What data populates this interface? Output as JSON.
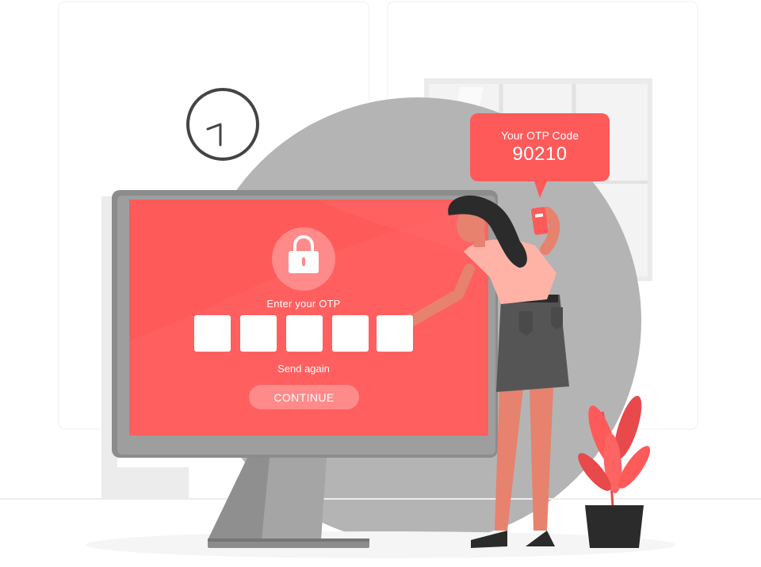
{
  "screen": {
    "prompt_label": "Enter your OTP",
    "otp_digits": [
      "",
      "",
      "",
      "",
      ""
    ],
    "resend_label": "Send again",
    "continue_label": "CONTINUE"
  },
  "notification": {
    "title": "Your OTP Code",
    "code": "90210"
  },
  "colors": {
    "accent_red": "#ff5a5a",
    "button_pink": "#ff8a8a",
    "circle_gray": "#b4b4b4",
    "monitor_frame": "#8c8c8c",
    "shorts": "#555555",
    "skin": "#e6826e",
    "shirt": "#ffb3a6",
    "hair": "#2b2b2b"
  },
  "icons": [
    "lock-icon",
    "clock-icon",
    "phone-icon",
    "plant-icon"
  ]
}
